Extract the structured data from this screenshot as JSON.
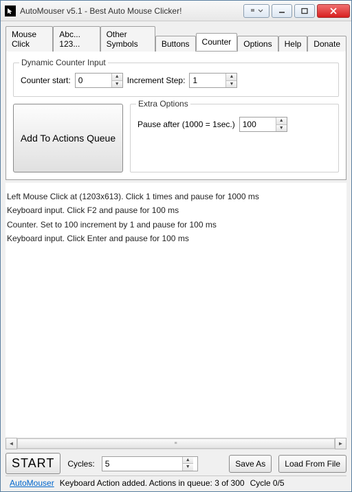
{
  "window": {
    "title": "AutoMouser v5.1 - Best Auto Mouse Clicker!"
  },
  "tabs": [
    "Mouse Click",
    "Abc... 123...",
    "Other Symbols",
    "Buttons",
    "Counter",
    "Options",
    "Help",
    "Donate"
  ],
  "active_tab_index": 4,
  "counter_group": {
    "legend": "Dynamic Counter Input",
    "start_label": "Counter start:",
    "start_value": "0",
    "step_label": "Increment Step:",
    "step_value": "1"
  },
  "add_button": "Add To Actions Queue",
  "extra_group": {
    "legend": "Extra Options",
    "pause_label": "Pause after (1000 = 1sec.)",
    "pause_value": "100"
  },
  "log_lines": [
    "Left Mouse Click at  (1203x613). Click 1 times and pause for 1000 ms",
    "Keyboard input. Click F2 and pause for 100 ms",
    "Counter. Set to 100 increment by 1 and pause for 100 ms",
    "Keyboard input. Click Enter and pause for 100 ms"
  ],
  "bottom": {
    "start": "START",
    "cycles_label": "Cycles:",
    "cycles_value": "5",
    "save_as": "Save As",
    "load_from_file": "Load From File"
  },
  "status": {
    "link": "AutoMouser",
    "message": "Keyboard Action added. Actions in queue: 3 of 300",
    "cycle": "Cycle 0/5"
  }
}
